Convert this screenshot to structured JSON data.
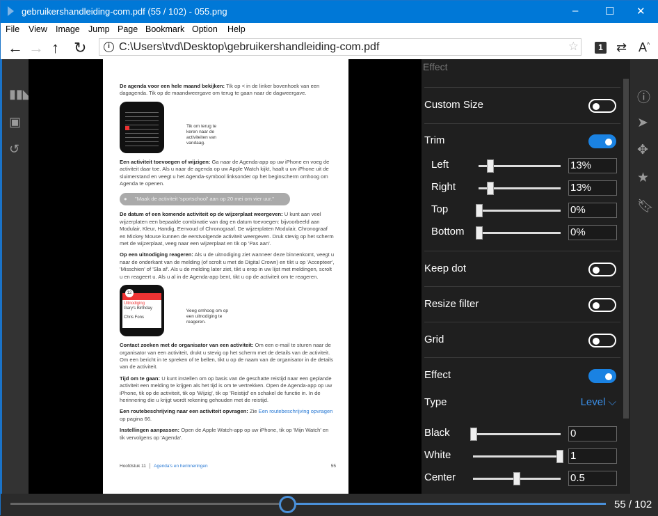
{
  "window": {
    "title": "gebruikershandleiding-com.pdf (55 / 102) - 055.png",
    "minimize": "–",
    "maximize": "☐",
    "close": "✕"
  },
  "menu": [
    "File",
    "View",
    "Image",
    "Jump",
    "Page",
    "Bookmark",
    "Option",
    "Help"
  ],
  "toolbar": {
    "address": "C:\\Users\\tvd\\Desktop\\gebruikershandleiding-com.pdf",
    "page_badge": "1"
  },
  "document": {
    "p1_bold": "De agenda voor een hele maand bekijken:",
    "p1": " Tik op < in de linker bovenhoek van een dagagenda. Tik op de maandweergave om terug te gaan naar de dagweergave.",
    "callout1": "Tik om terug te keren naar de activiteiten van vandaag.",
    "p2_bold": "Een activiteit toevoegen of wijzigen:",
    "p2": " Ga naar de Agenda-app op uw iPhone en voeg de activiteit daar toe. Als u naar de agenda op uw Apple Watch kijkt, haalt u uw iPhone uit de sluimerstand en veegt u het Agenda-symbool linksonder op het beginscherm omhoog om Agenda te openen.",
    "siri": "\"Maak de activiteit 'sportschool' aan op 20 mei om vier uur.\"",
    "p3_bold": "De datum of een komende activiteit op de wijzerplaat weergeven:",
    "p3": " U kunt aan veel wijzerplaten een bepaalde combinatie van dag en datum toevoegen: bijvoorbeeld aan Modulair, Kleur, Handig, Eenvoud of Chronograaf. De wijzerplaten Modulair, Chronograaf en Mickey Mouse kunnen de eerstvolgende activiteit weergeven. Druk stevig op het scherm met de wijzerplaat, veeg naar een wijzerplaat en tik op 'Pas aan'.",
    "p4_bold": "Op een uitnodiging reageren:",
    "p4": " Als u de uitnodiging ziet wanneer deze binnenkomt, veegt u naar de onderkant van de melding (of scrolt u met de Digital Crown) en tikt u op 'Accepteer', 'Misschien' of 'Sla af'. Als u de melding later ziet, tikt u erop in uw lijst met meldingen, scrolt u en reageert u. Als u al in de Agenda-app bent, tikt u op de activiteit om te reageren.",
    "callout2": "Veeg omhoog om op een uitnodiging te reageren.",
    "watch2": {
      "date": "12",
      "label": "Uitnodiging",
      "event": "Gary's Birthday",
      "person": "Chris Fons"
    },
    "p5_bold": "Contact zoeken met de organisator van een activiteit:",
    "p5": " Om een e-mail te sturen naar de organisator van een activiteit, drukt u stevig op het scherm met de details van de activiteit. Om een bericht in te spreken of te bellen, tikt u op de naam van de organisator in de details van de activiteit.",
    "p6_bold": "Tijd om te gaan:",
    "p6": " U kunt instellen om op basis van de geschatte reistijd naar een geplande activiteit een melding te krijgen als het tijd is om te vertrekken. Open de Agenda-app op uw iPhone, tik op de activiteit, tik op 'Wijzig', tik op 'Reistijd' en schakel de functie in. In de herinnering die u krijgt wordt rekening gehouden met de reistijd.",
    "p7_bold": "Een routebeschrijving naar een activiteit opvragen:",
    "p7_a": " Zie ",
    "p7_link": "Een routebeschrijving opvragen",
    "p7_b": " op pagina 66.",
    "p8_bold": "Instellingen aanpassen:",
    "p8": " Open de Apple Watch-app op uw iPhone, tik op 'Mijn Watch' en tik vervolgens op 'Agenda'.",
    "footer_chapter": "Hoofdstuk 11",
    "footer_title": "Agenda's en herinneringen",
    "footer_page": "55"
  },
  "panel": {
    "header": "Effect",
    "custom_size": {
      "label": "Custom Size",
      "on": false
    },
    "trim": {
      "label": "Trim",
      "on": true,
      "left": {
        "label": "Left",
        "value": "13%",
        "fraction": 0.13
      },
      "right": {
        "label": "Right",
        "value": "13%",
        "fraction": 0.13
      },
      "top": {
        "label": "Top",
        "value": "0%",
        "fraction": 0
      },
      "bottom": {
        "label": "Bottom",
        "value": "0%",
        "fraction": 0
      }
    },
    "keep_dot": {
      "label": "Keep dot",
      "on": false
    },
    "resize_filter": {
      "label": "Resize filter",
      "on": false
    },
    "grid": {
      "label": "Grid",
      "on": false
    },
    "effect": {
      "label": "Effect",
      "on": true
    },
    "type": {
      "label": "Type",
      "value": "Level"
    },
    "black": {
      "label": "Black",
      "value": "0",
      "fraction": 0
    },
    "white": {
      "label": "White",
      "value": "1",
      "fraction": 1
    },
    "center": {
      "label": "Center",
      "value": "0.5",
      "fraction": 0.5
    }
  },
  "bottom": {
    "page_counter": "55 / 102",
    "progress": 0.5294
  },
  "colors": {
    "accent": "#0078d7",
    "toggle_on": "#1a82e2",
    "panel_bg": "#1f1f1f"
  }
}
